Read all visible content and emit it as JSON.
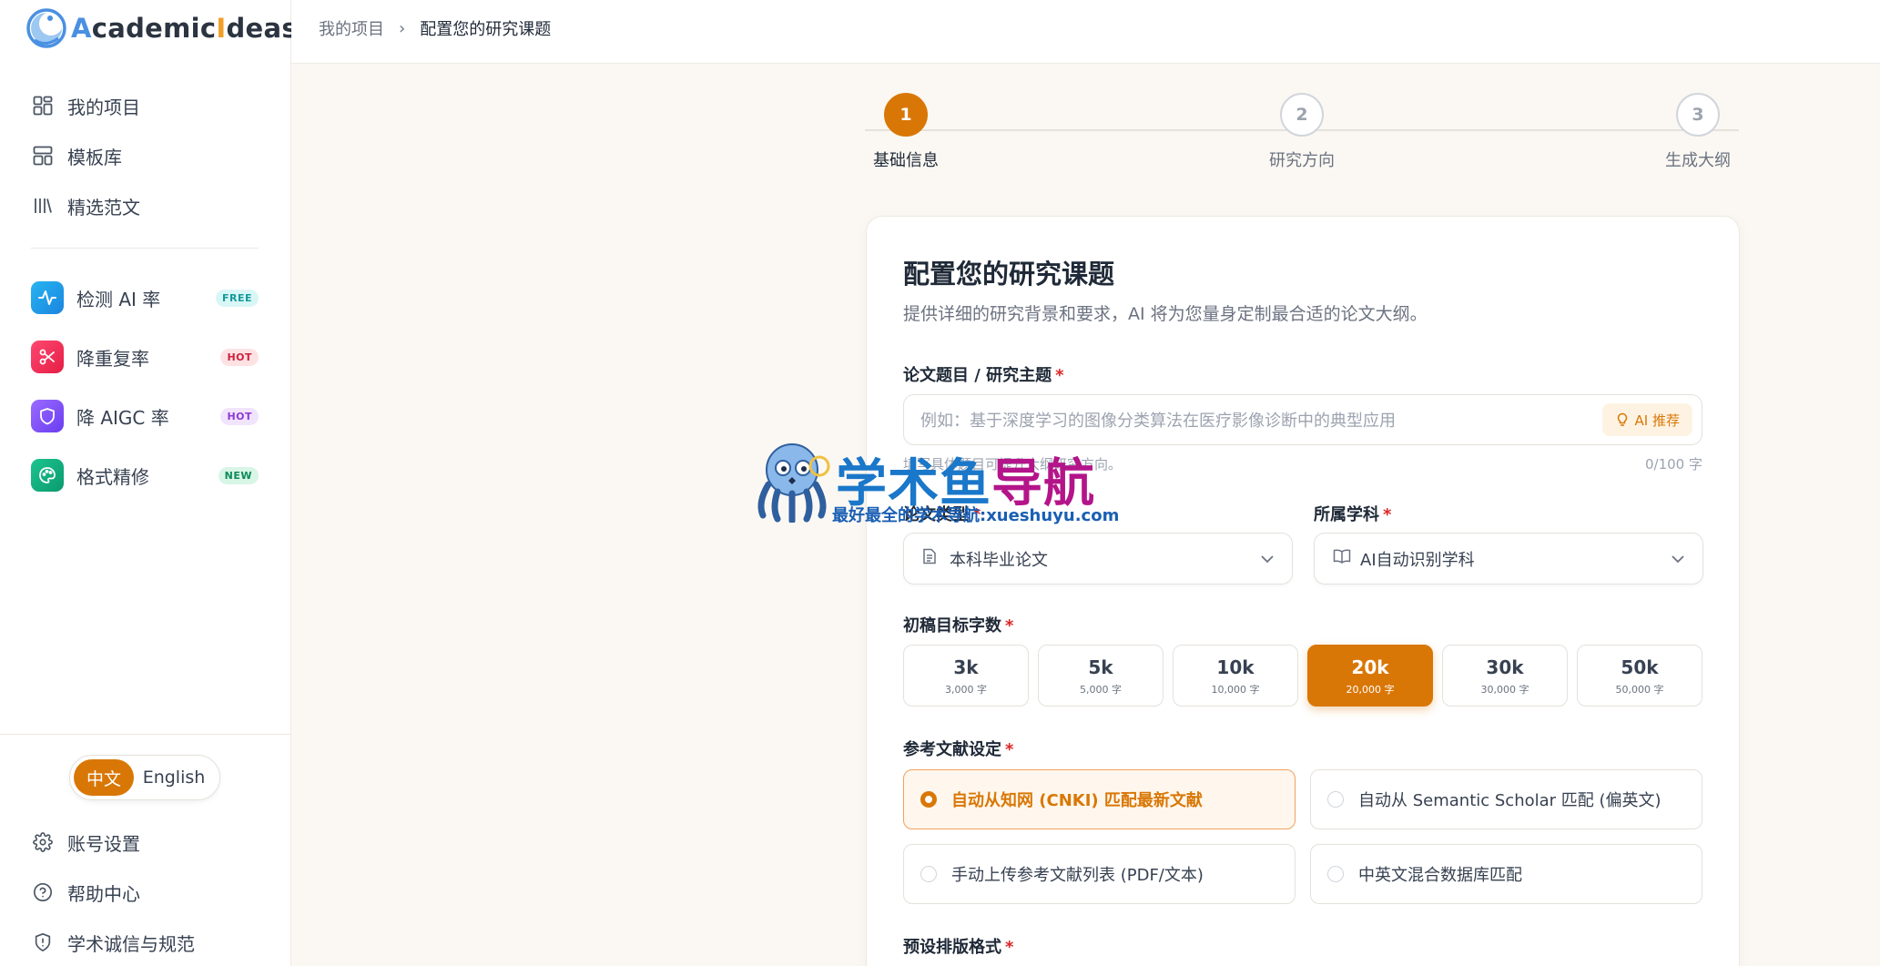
{
  "brand": {
    "logo_parts": [
      "A",
      "cademic",
      "I",
      "deas"
    ]
  },
  "sidebar": {
    "nav": [
      {
        "label": "我的项目",
        "icon": "dashboard-grid-icon"
      },
      {
        "label": "模板库",
        "icon": "layout-template-icon"
      },
      {
        "label": "精选范文",
        "icon": "library-books-icon"
      }
    ],
    "tools": [
      {
        "label": "检测 AI 率",
        "icon": "activity-pulse-icon",
        "badge": "FREE",
        "icon_color": "#1b9be6",
        "badge_bg": "#d9f6f6",
        "badge_color": "#159a9c"
      },
      {
        "label": "降重复率",
        "icon": "scissors-icon",
        "badge": "HOT",
        "icon_color": "#ef2d55",
        "badge_bg": "#fde2e4",
        "badge_color": "#d0213d"
      },
      {
        "label": "降 AIGC 率",
        "icon": "shield-icon",
        "badge": "HOT",
        "icon_color": "#7c4dff",
        "badge_bg": "#f1e4fd",
        "badge_color": "#8e3ad6"
      },
      {
        "label": "格式精修",
        "icon": "palette-icon",
        "badge": "NEW",
        "icon_color": "#10a97a",
        "badge_bg": "#d8f5e6",
        "badge_color": "#0e8a5b"
      }
    ],
    "lang": {
      "active": "中文",
      "inactive": "English"
    },
    "bottom": [
      {
        "label": "账号设置",
        "icon": "gear-icon"
      },
      {
        "label": "帮助中心",
        "icon": "help-circle-icon"
      },
      {
        "label": "学术诚信与规范",
        "icon": "shield-alert-icon"
      }
    ]
  },
  "header": {
    "breadcrumb_root": "我的项目",
    "breadcrumb_sep": "›",
    "breadcrumb_current": "配置您的研究课题"
  },
  "stepper": {
    "steps": [
      {
        "num": "1",
        "label": "基础信息",
        "active": true
      },
      {
        "num": "2",
        "label": "研究方向",
        "active": false
      },
      {
        "num": "3",
        "label": "生成大纲",
        "active": false
      }
    ]
  },
  "form": {
    "title": "配置您的研究课题",
    "subtitle": "提供详细的研究背景和要求，AI 将为您量身定制最合适的论文大纲。",
    "topic_label": "论文题目 / 研究主题",
    "topic_placeholder": "例如：基于深度学习的图像分类算法在医疗影像诊断中的典型应用",
    "ai_button": "AI 推荐",
    "topic_hint": "填写具体题目可提升大纲研究方向。",
    "topic_count": "0/100 字",
    "type_label": "论文类型",
    "type_value": "本科毕业论文",
    "subject_label": "所属学科",
    "subject_value": "AI自动识别学科",
    "wordcount_label": "初稿目标字数",
    "wordcount_options": [
      {
        "big": "3k",
        "small": "3,000 字",
        "active": false
      },
      {
        "big": "5k",
        "small": "5,000 字",
        "active": false
      },
      {
        "big": "10k",
        "small": "10,000 字",
        "active": false
      },
      {
        "big": "20k",
        "small": "20,000 字",
        "active": true
      },
      {
        "big": "30k",
        "small": "30,000 字",
        "active": false
      },
      {
        "big": "50k",
        "small": "50,000 字",
        "active": false
      }
    ],
    "ref_label": "参考文献设定",
    "ref_options": [
      {
        "label": "自动从知网 (CNKI) 匹配最新文献",
        "active": true
      },
      {
        "label": "自动从 Semantic Scholar 匹配 (偏英文)",
        "active": false
      },
      {
        "label": "手动上传参考文献列表 (PDF/文本)",
        "active": false
      },
      {
        "label": "中英文混合数据库匹配",
        "active": false
      }
    ],
    "format_label": "预设排版格式",
    "required_mark": "*"
  },
  "watermark": {
    "title_a": "学术鱼",
    "title_b": "导航",
    "sub": "最好最全的学术导航:xueshuyu.com"
  },
  "colors": {
    "accent": "#d97706",
    "accent_light": "#fff7ed",
    "required": "#dc2626"
  }
}
